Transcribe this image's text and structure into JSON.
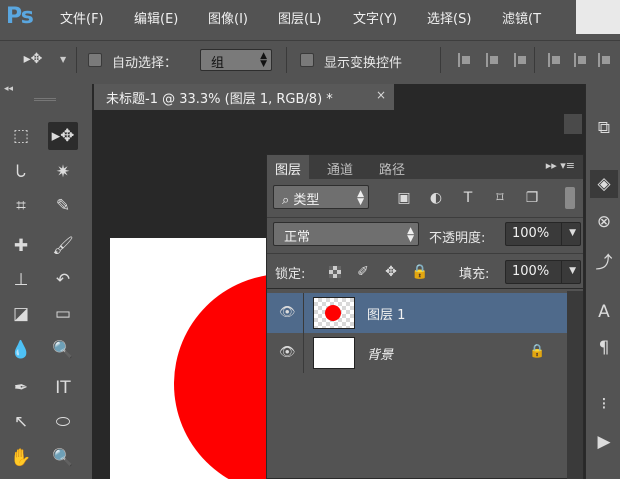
{
  "app": {
    "logo": "Ps"
  },
  "menu": [
    {
      "id": "file",
      "label": "文件(F)"
    },
    {
      "id": "edit",
      "label": "编辑(E)"
    },
    {
      "id": "image",
      "label": "图像(I)"
    },
    {
      "id": "layer",
      "label": "图层(L)"
    },
    {
      "id": "type",
      "label": "文字(Y)"
    },
    {
      "id": "select",
      "label": "选择(S)"
    },
    {
      "id": "filter",
      "label": "滤镜(T"
    }
  ],
  "options": {
    "auto_select_label": "自动选择：",
    "auto_select_value": "组",
    "show_transform_label": "显示变换控件"
  },
  "document": {
    "tab_title": "未标题-1 @ 33.3% (图层 1, RGB/8) *",
    "close_glyph": "×"
  },
  "layers_panel": {
    "tabs": [
      {
        "id": "layers",
        "label": "图层",
        "active": true
      },
      {
        "id": "channels",
        "label": "通道",
        "active": false
      },
      {
        "id": "paths",
        "label": "路径",
        "active": false
      }
    ],
    "menu_glyph": "▸▸ ▾≡",
    "filter": {
      "search_glyph": "⌕",
      "value": "类型"
    },
    "blend_mode": "正常",
    "opacity": {
      "label": "不透明度:",
      "value": "100%"
    },
    "lock": {
      "label": "锁定:"
    },
    "fill": {
      "label": "填充:",
      "value": "100%"
    },
    "layers": [
      {
        "name": "图层 1",
        "selected": true,
        "visible": true,
        "locked": false
      },
      {
        "name": "背景",
        "selected": false,
        "visible": true,
        "locked": true
      }
    ]
  },
  "colors": {
    "shape_red": "#ff0000",
    "selection_blue": "#4f6a8b",
    "ps_blue": "#5aa7e0"
  }
}
